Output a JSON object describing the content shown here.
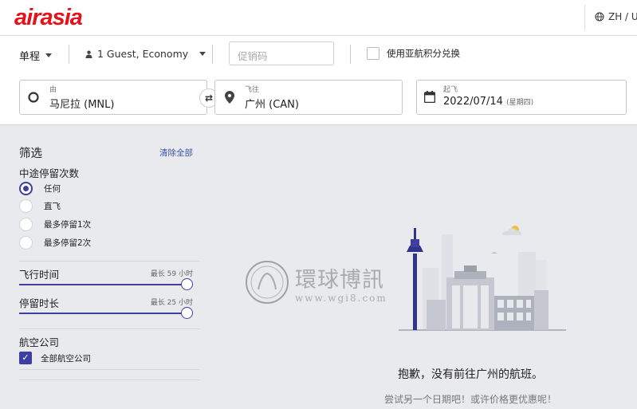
{
  "brand": {
    "logo": "airasia",
    "color": "#e3121b"
  },
  "header": {
    "language": "ZH / U"
  },
  "search": {
    "trip_type": "单程",
    "passengers": "1 Guest, Economy",
    "promo_placeholder": "促销码",
    "points_label": "使用亚航积分兑换",
    "origin_label": "由",
    "origin_value": "马尼拉 (MNL)",
    "dest_label": "飞往",
    "dest_value": "广州 (CAN)",
    "depart_label": "起飞",
    "depart_date": "2022/07/14",
    "depart_weekday": "(星期四)"
  },
  "filters": {
    "title": "筛选",
    "clear_all": "清除全部",
    "stops_title": "中途停留次数",
    "stops_options": [
      "任何",
      "直飞",
      "最多停留1次",
      "最多停留2次"
    ],
    "stops_selected": 0,
    "flight_time_label": "飞行时间",
    "flight_time_max": "最长 59 小时",
    "layover_label": "停留时长",
    "layover_max": "最长 25 小时",
    "airlines_title": "航空公司",
    "all_airlines": "全部航空公司",
    "all_airlines_checked": true
  },
  "results": {
    "empty_title": "抱歉，没有前往广州的航班。",
    "empty_subtitle": "尝试另一个日期吧！或许价格更优惠呢！"
  },
  "watermark": {
    "title": "環球博訊",
    "url": "www.wgi8.com"
  },
  "colors": {
    "accent": "#3e3fa0",
    "link": "#3c53a4",
    "background": "#e9eaee"
  }
}
